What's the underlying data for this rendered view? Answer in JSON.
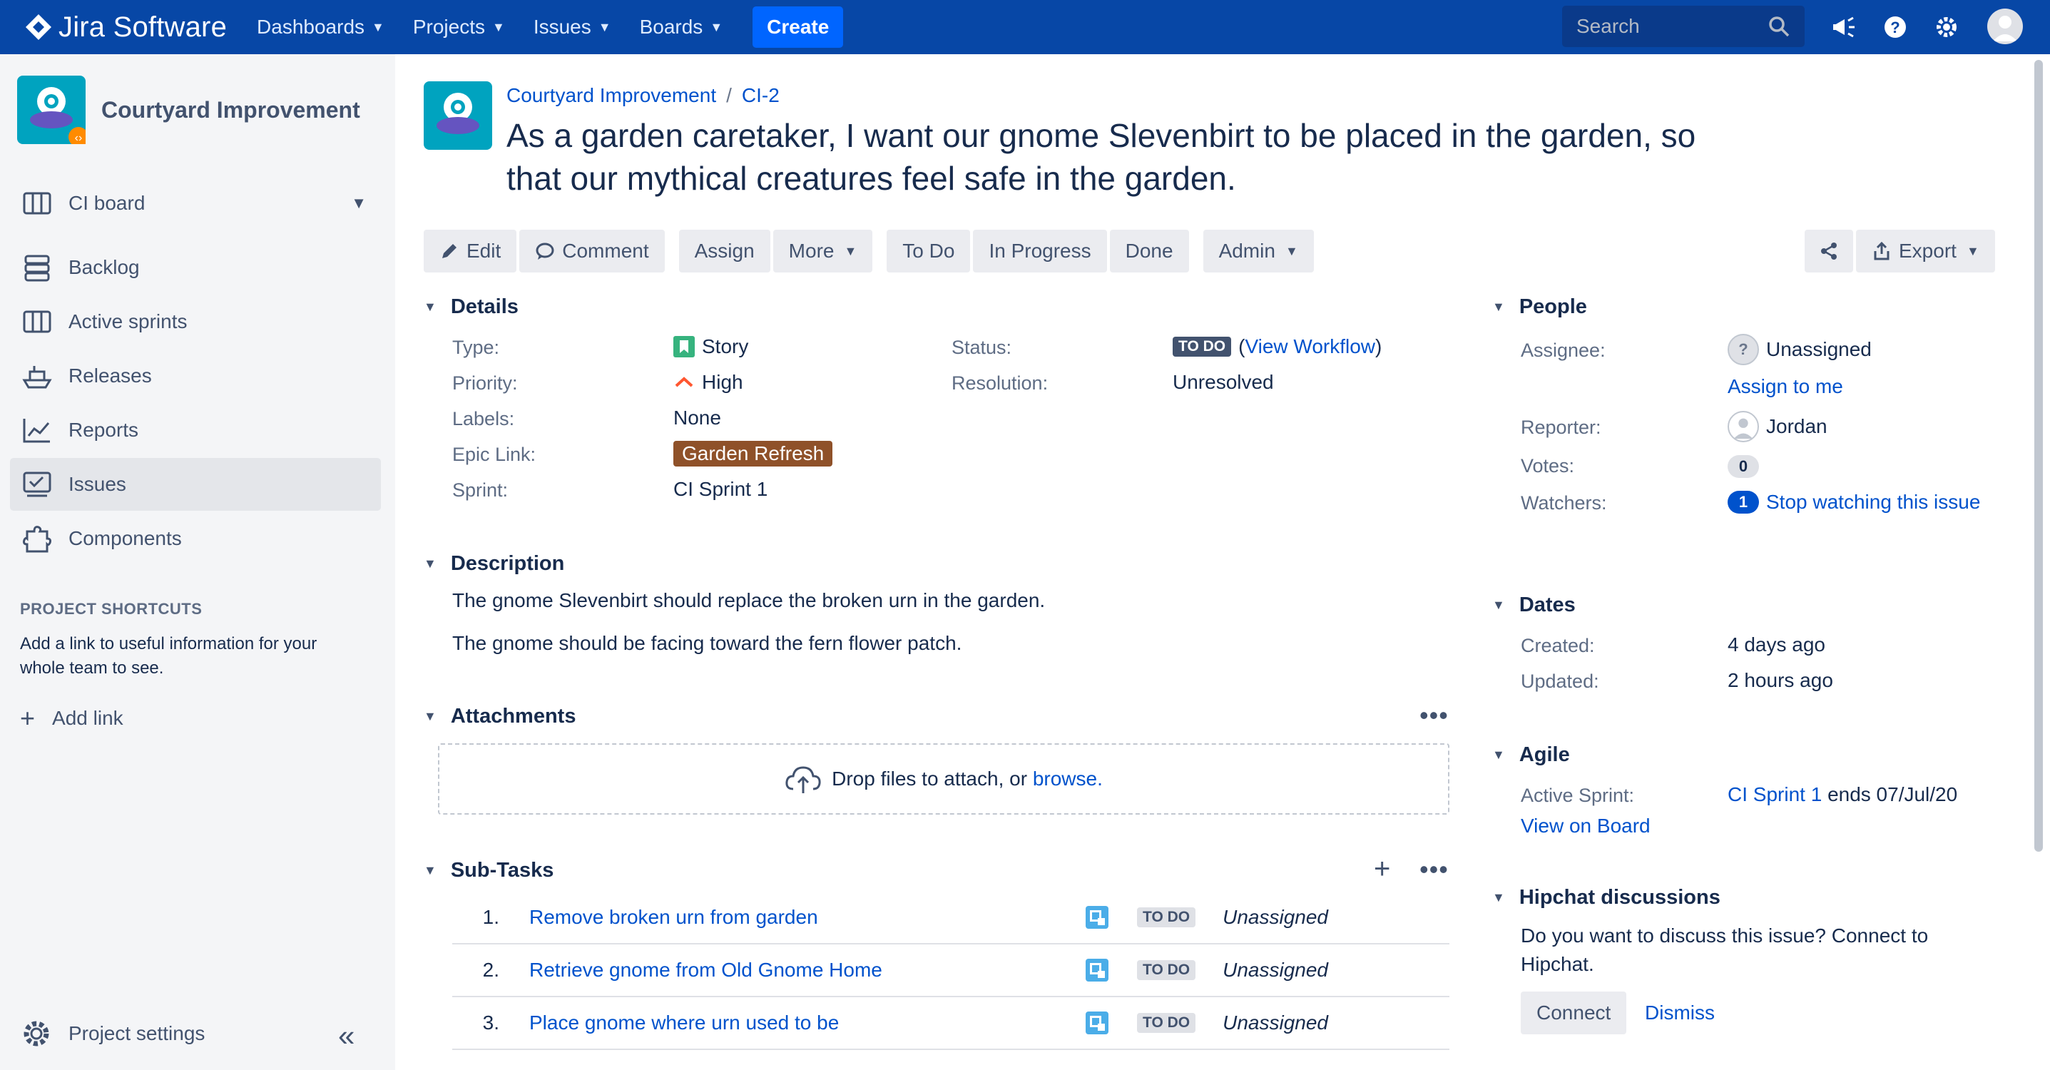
{
  "nav": {
    "product": "Jira Software",
    "items": [
      {
        "label": "Dashboards"
      },
      {
        "label": "Projects"
      },
      {
        "label": "Issues"
      },
      {
        "label": "Boards"
      }
    ],
    "create_label": "Create",
    "search_placeholder": "Search"
  },
  "sidebar": {
    "project_name": "Courtyard Improvement",
    "board_selector": "CI board",
    "items": [
      {
        "label": "Backlog",
        "icon": "backlog-icon"
      },
      {
        "label": "Active sprints",
        "icon": "board-icon"
      },
      {
        "label": "Releases",
        "icon": "ship-icon"
      },
      {
        "label": "Reports",
        "icon": "chart-icon"
      },
      {
        "label": "Issues",
        "icon": "issues-icon",
        "active": true
      },
      {
        "label": "Components",
        "icon": "puzzle-icon"
      }
    ],
    "shortcuts_heading": "PROJECT SHORTCUTS",
    "shortcuts_text": "Add a link to useful information for your whole team to see.",
    "add_link": "Add link",
    "project_settings": "Project settings"
  },
  "issue": {
    "breadcrumb_project": "Courtyard Improvement",
    "breadcrumb_sep": "/",
    "key": "CI-2",
    "title": "As a garden caretaker, I want our gnome Slevenbirt to be placed in the garden, so that our mythical creatures feel safe in the garden."
  },
  "toolbar": {
    "edit": "Edit",
    "comment": "Comment",
    "assign": "Assign",
    "more": "More",
    "todo": "To Do",
    "in_progress": "In Progress",
    "done": "Done",
    "admin": "Admin",
    "export": "Export"
  },
  "details": {
    "heading": "Details",
    "type_label": "Type:",
    "type_value": "Story",
    "priority_label": "Priority:",
    "priority_value": "High",
    "labels_label": "Labels:",
    "labels_value": "None",
    "epic_label": "Epic Link:",
    "epic_value": "Garden Refresh",
    "sprint_label": "Sprint:",
    "sprint_value": "CI Sprint 1",
    "status_label": "Status:",
    "status_value": "TO DO",
    "view_workflow_open": "(",
    "view_workflow": "View Workflow",
    "view_workflow_close": ")",
    "resolution_label": "Resolution:",
    "resolution_value": "Unresolved"
  },
  "description": {
    "heading": "Description",
    "lines": [
      "The gnome Slevenbirt should replace the broken urn in the garden.",
      "The gnome should be facing toward the fern flower patch."
    ]
  },
  "attachments": {
    "heading": "Attachments",
    "drop_text": "Drop files to attach, or",
    "browse": "browse."
  },
  "subtasks": {
    "heading": "Sub-Tasks",
    "rows": [
      {
        "num": "1.",
        "name": "Remove broken urn from garden",
        "status": "TO DO",
        "assignee": "Unassigned"
      },
      {
        "num": "2.",
        "name": "Retrieve gnome from Old Gnome Home",
        "status": "TO DO",
        "assignee": "Unassigned"
      },
      {
        "num": "3.",
        "name": "Place gnome where urn used to be",
        "status": "TO DO",
        "assignee": "Unassigned"
      }
    ]
  },
  "people": {
    "heading": "People",
    "assignee_label": "Assignee:",
    "assignee_value": "Unassigned",
    "assign_to_me": "Assign to me",
    "reporter_label": "Reporter:",
    "reporter_value": "Jordan",
    "votes_label": "Votes:",
    "votes_value": "0",
    "watchers_label": "Watchers:",
    "watchers_value": "1",
    "stop_watching": "Stop watching this issue"
  },
  "dates": {
    "heading": "Dates",
    "created_label": "Created:",
    "created_value": "4 days ago",
    "updated_label": "Updated:",
    "updated_value": "2 hours ago"
  },
  "agile": {
    "heading": "Agile",
    "active_sprint_label": "Active Sprint:",
    "sprint_link": "CI Sprint 1",
    "sprint_ends": "ends 07/Jul/20",
    "view_on_board": "View on Board"
  },
  "hipchat": {
    "heading": "Hipchat discussions",
    "text": "Do you want to discuss this issue? Connect to Hipchat.",
    "connect": "Connect",
    "dismiss": "Dismiss"
  },
  "colors": {
    "nav_bg": "#0747a6",
    "link": "#0052cc",
    "epic": "#8f5129",
    "priority_high": "#ff5630",
    "story": "#36b37e"
  }
}
